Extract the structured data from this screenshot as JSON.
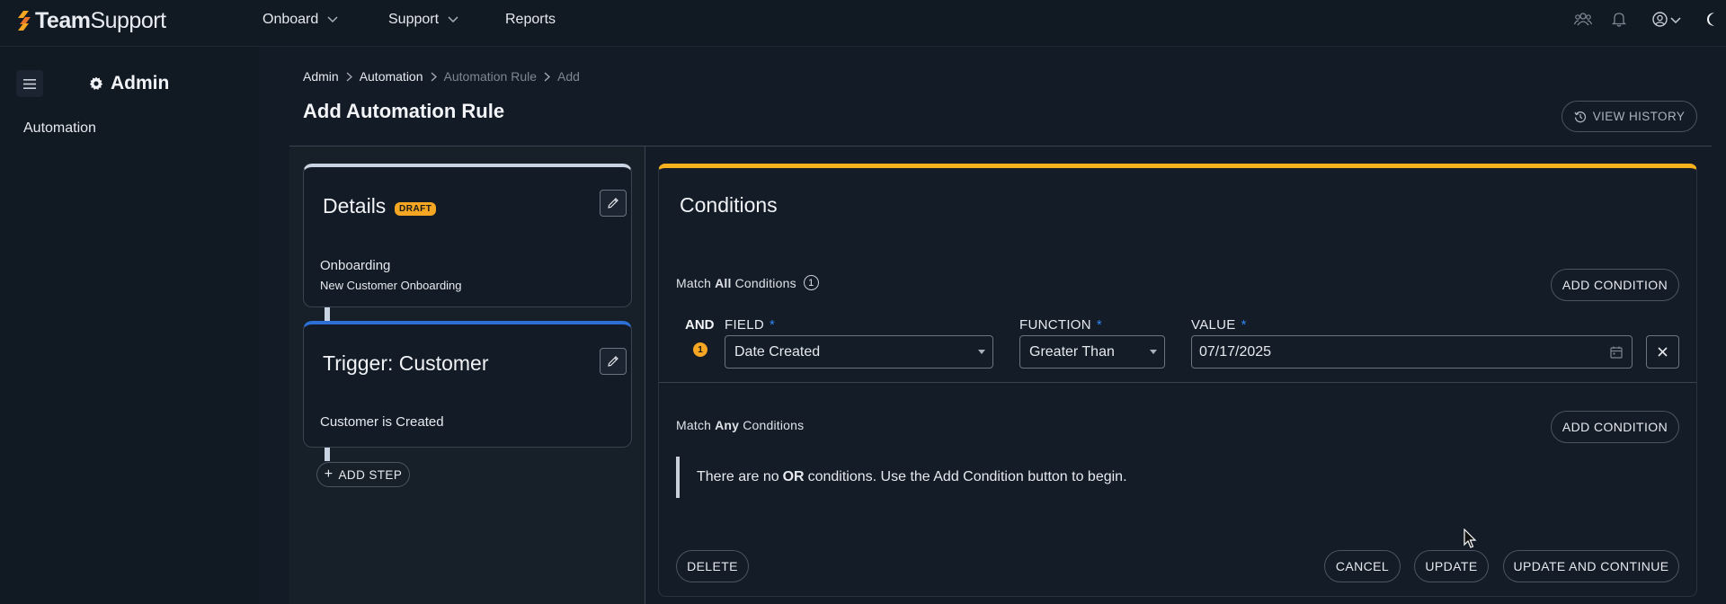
{
  "app": {
    "logo_text_bold": "Team",
    "logo_text_rest": "Support"
  },
  "topnav": {
    "items": [
      {
        "label": "Onboard",
        "has_dropdown": true
      },
      {
        "label": "Support",
        "has_dropdown": true
      },
      {
        "label": "Reports",
        "has_dropdown": false
      }
    ],
    "icons": [
      "people-icon",
      "bell-icon",
      "user-circle-icon",
      "chevron-down-icon",
      "moon-icon"
    ]
  },
  "sidebar": {
    "title": "Admin",
    "title_icon": "gear-icon",
    "items": [
      {
        "label": "Automation"
      }
    ]
  },
  "breadcrumb": {
    "items": [
      "Admin",
      "Automation",
      "Automation Rule",
      "Add"
    ]
  },
  "page": {
    "title": "Add Automation Rule",
    "view_history_label": "VIEW HISTORY"
  },
  "steps": {
    "details": {
      "title": "Details",
      "badge": "DRAFT",
      "line1": "Onboarding",
      "line2": "New Customer Onboarding"
    },
    "trigger": {
      "title": "Trigger: Customer",
      "line1": "Customer is Created"
    },
    "add_step_label": "ADD STEP"
  },
  "conditions": {
    "title": "Conditions",
    "all": {
      "prefix": "Match",
      "keyword": "All",
      "suffix": "Conditions",
      "count": "1",
      "add_label": "ADD CONDITION",
      "rows": [
        {
          "operator": "AND",
          "index": "1",
          "field_label": "FIELD",
          "field_value": "Date Created",
          "function_label": "FUNCTION",
          "function_value": "Greater Than",
          "value_label": "VALUE",
          "value": "07/17/2025",
          "required_mark": "*"
        }
      ]
    },
    "any": {
      "prefix": "Match",
      "keyword": "Any",
      "suffix": "Conditions",
      "add_label": "ADD CONDITION",
      "empty_pre": "There are no",
      "empty_keyword": "OR",
      "empty_post": "conditions. Use the Add Condition button to begin."
    }
  },
  "footer": {
    "delete_label": "DELETE",
    "cancel_label": "CANCEL",
    "update_label": "UPDATE",
    "update_continue_label": "UPDATE AND CONTINUE"
  },
  "colors": {
    "accent_orange": "#f5a623",
    "accent_blue": "#2d6fd6",
    "background": "#131b26"
  }
}
